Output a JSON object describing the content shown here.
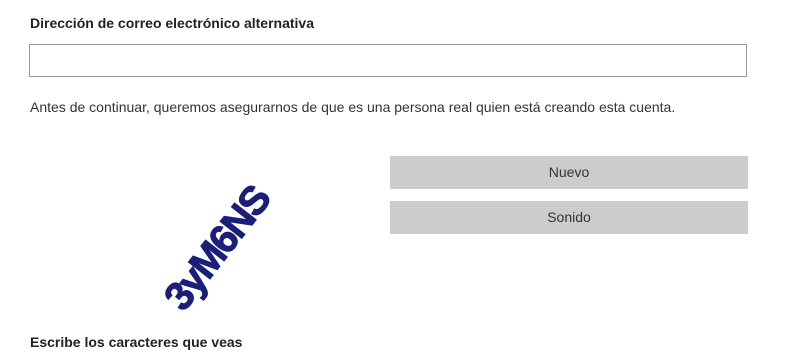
{
  "form": {
    "alt_email_label": "Dirección de correo electrónico alternativa",
    "alt_email_value": "",
    "notice_text": "Antes de continuar, queremos asegurarnos de que es una persona real quien está creando esta cuenta.",
    "captcha": {
      "text": "3yM6NS",
      "color": "#1a1f7a"
    },
    "new_button_label": "Nuevo",
    "sound_button_label": "Sonido",
    "captcha_input_label": "Escribe los caracteres que veas"
  }
}
